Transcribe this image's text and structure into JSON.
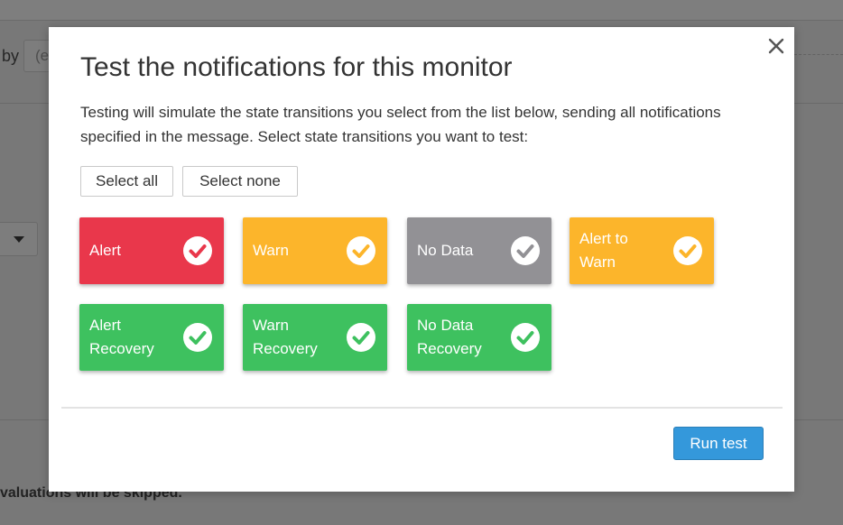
{
  "background": {
    "by_label": "by",
    "input_partial": "(e",
    "footer_text": "valuations will be skipped."
  },
  "modal": {
    "title": "Test the notifications for this monitor",
    "description": "Testing will simulate the state transitions you select from the list below, sending all notifications specified in the message. Select state transitions you want to test:",
    "close_icon": "close-icon",
    "select_all_label": "Select all",
    "select_none_label": "Select none",
    "run_label": "Run test",
    "tiles": [
      {
        "label_lines": [
          "Alert"
        ],
        "color": "#e9374b",
        "check_color": "#e9374b",
        "checked": true
      },
      {
        "label_lines": [
          "Warn"
        ],
        "color": "#fcb52b",
        "check_color": "#fcb52b",
        "checked": true
      },
      {
        "label_lines": [
          "No Data"
        ],
        "color": "#929195",
        "check_color": "#929195",
        "checked": true
      },
      {
        "label_lines": [
          "Alert to",
          "Warn"
        ],
        "color": "#fcb52b",
        "check_color": "#fcb52b",
        "checked": true
      },
      {
        "label_lines": [
          "Alert",
          "Recovery"
        ],
        "color": "#3ec15f",
        "check_color": "#3ec15f",
        "checked": true
      },
      {
        "label_lines": [
          "Warn",
          "Recovery"
        ],
        "color": "#3ec15f",
        "check_color": "#3ec15f",
        "checked": true
      },
      {
        "label_lines": [
          "No Data",
          "Recovery"
        ],
        "color": "#3ec15f",
        "check_color": "#3ec15f",
        "checked": true
      }
    ]
  },
  "colors": {
    "run_button": "#3498db",
    "overlay": "#787878"
  }
}
